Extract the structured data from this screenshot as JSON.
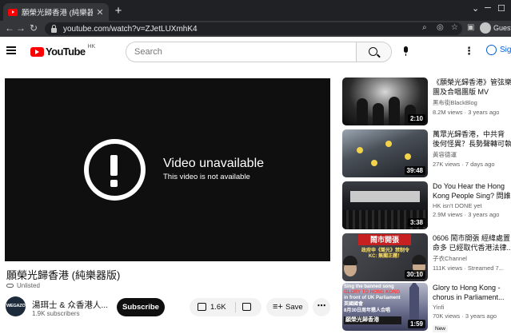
{
  "browser": {
    "tab_title": "願榮光歸香港 (純樂器版) - YouTu",
    "tab_close": "✕",
    "new_tab": "+",
    "url": "youtube.com/watch?v=ZJetLUXmhK4",
    "profile_label": "Guest"
  },
  "header": {
    "logo_text": "YouTube",
    "country_code": "HK",
    "search_placeholder": "Search",
    "signin_label": "Sign in"
  },
  "player": {
    "error_title": "Video unavailable",
    "error_subtitle": "This video is not available"
  },
  "video": {
    "title": "願榮光歸香港 (純樂器版)",
    "visibility": "Unlisted",
    "channel_name": "湯珥士 & 众香港人...",
    "subscribers": "1.9K subscribers",
    "avatar_text": "WEGAZO",
    "subscribe_label": "Subscribe",
    "likes": "1.6K",
    "save_label": "Save"
  },
  "recommendations": [
    {
      "title": "《願榮光歸香港》管弦樂",
      "title2": "團及合唱團版 MV",
      "channel": "黑布街BlackBlog",
      "views": "8.2M views",
      "age": "3 years ago",
      "duration": "2:10"
    },
    {
      "title": "萬眾光歸香港，中共背",
      "title2": "後何怪異？長勢聲轉可執",
      "channel": "黃容德運",
      "views": "27K views",
      "age": "7 days ago",
      "duration": "39:48"
    },
    {
      "title": "Do You Hear the Hong",
      "title2": "Kong People Sing? 問誰...",
      "channel": "HK isn't DONE yet",
      "views": "2.9M views",
      "age": "3 years ago",
      "duration": "3:38"
    },
    {
      "title": "0606 鬧市開張 經緯處置",
      "title2": "命多 已經取代香港法律...",
      "channel": "子衣Channel",
      "views": "111K views",
      "age": "Streamed 7...",
      "duration": "30:10",
      "thumb_banner": "鬧市開張",
      "thumb_caption": "政府申《榮光》禁制令 KC: 無關正題！"
    },
    {
      "title": "Glory to Hong Kong -",
      "title2": "chorus in Parliament...",
      "channel": "Yinfi",
      "views": "70K views",
      "age": "3 years ago",
      "duration": "1:59",
      "badge": "New",
      "thumb_line1": "Sing the banned song",
      "thumb_line2": "GLORY TO HONG KONG",
      "thumb_line3": "in front of UK Parliament",
      "thumb_line4": "英國國會",
      "thumb_line5": "8月30日周年懇人合唱",
      "thumb_banner": "願榮光歸香港"
    }
  ]
}
